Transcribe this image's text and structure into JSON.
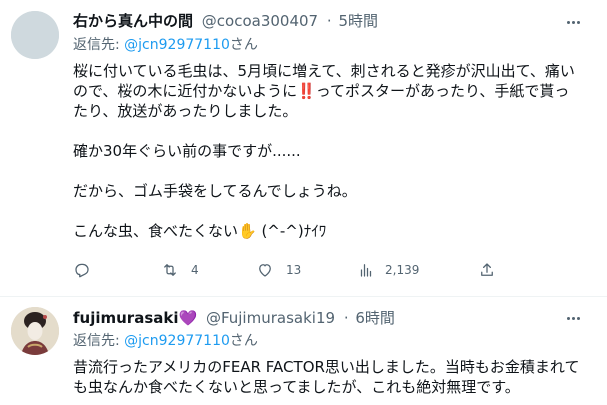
{
  "tweets": [
    {
      "display_name": "右から真ん中の間",
      "handle": "@cocoa300407",
      "separator": "·",
      "time": "5時間",
      "reply_prefix": "返信先:",
      "reply_handle": "@jcn92977110",
      "reply_suffix": "さん",
      "text_lines": [
        "桜に付いている毛虫は、5月頃に増えて、刺されると発疹が沢山出て、痛い",
        "ので、桜の木に近付かないように‼️ってポスターがあったり、手紙で貰っ",
        "たり、放送があったりしました。",
        "",
        "確か30年ぐらい前の事ですが......",
        "",
        "だから、ゴム手袋をしてるんでしょうね。",
        "",
        "こんな虫、食べたくない✋ (^-^)ﾅｲﾜ"
      ],
      "replies": "4",
      "likes": "13",
      "views": "2,139"
    },
    {
      "display_name": "fujimurasaki💜",
      "handle": "@Fujimurasaki19",
      "separator": "·",
      "time": "6時間",
      "reply_prefix": "返信先:",
      "reply_handle": "@jcn92977110",
      "reply_suffix": "さん",
      "text_lines": [
        "昔流行ったアメリカのFEAR FACTOR思い出しました。当時もお金積まれて",
        "も虫なんか食べたくないと思ってましたが、これも絶対無理です。"
      ]
    }
  ],
  "icons": {
    "more": "more-horizontal-icon",
    "reply": "reply-icon",
    "retweet": "retweet-icon",
    "like": "heart-icon",
    "views": "views-chart-icon",
    "share": "share-icon"
  },
  "colors": {
    "link": "#1d9bf0",
    "secondary_text": "#536471",
    "primary_text": "#0f1419",
    "divider": "#eff3f4"
  }
}
